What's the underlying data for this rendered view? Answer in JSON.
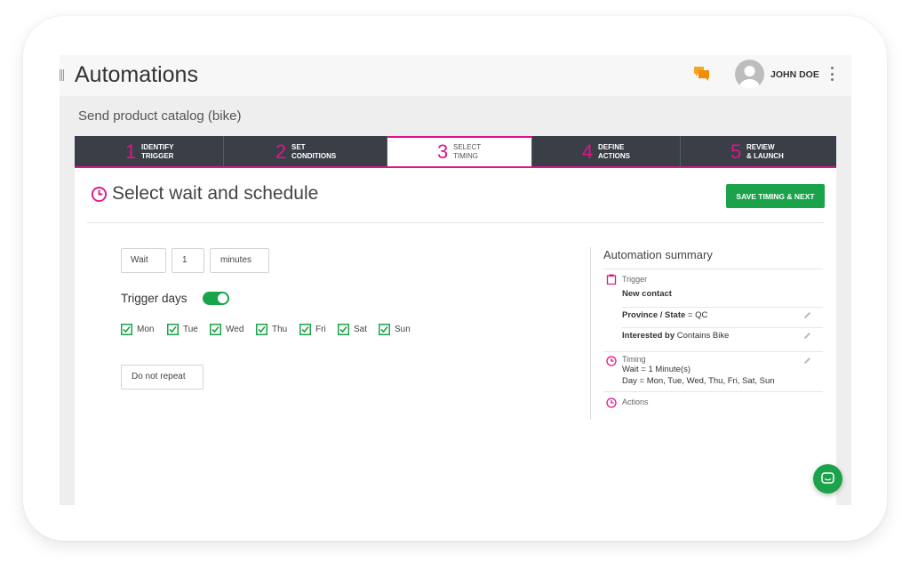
{
  "app": {
    "title": "Automations"
  },
  "user": {
    "name": "JOHN DOE"
  },
  "automation": {
    "name": "Send product catalog (bike)"
  },
  "steps": [
    {
      "num": "1",
      "line1": "IDENTIFY",
      "line2": "TRIGGER",
      "active": false
    },
    {
      "num": "2",
      "line1": "SET",
      "line2": "CONDITIONS",
      "active": false
    },
    {
      "num": "3",
      "line1": "SELECT",
      "line2": "TIMING",
      "active": true
    },
    {
      "num": "4",
      "line1": "DEFINE",
      "line2": "ACTIONS",
      "active": false
    },
    {
      "num": "5",
      "line1": "REVIEW",
      "line2": "& LAUNCH",
      "active": false
    }
  ],
  "page": {
    "title": "Select wait and schedule",
    "save_button": "SAVE TIMING & NEXT"
  },
  "wait": {
    "label": "Wait",
    "value": "1",
    "unit": "minutes"
  },
  "trigger_days": {
    "label": "Trigger days",
    "enabled": true,
    "days": [
      {
        "label": "Mon",
        "checked": true
      },
      {
        "label": "Tue",
        "checked": true
      },
      {
        "label": "Wed",
        "checked": true
      },
      {
        "label": "Thu",
        "checked": true
      },
      {
        "label": "Fri",
        "checked": true
      },
      {
        "label": "Sat",
        "checked": true
      },
      {
        "label": "Sun",
        "checked": true
      }
    ]
  },
  "repeat": {
    "value": "Do not repeat"
  },
  "summary": {
    "title": "Automation summary",
    "trigger_label": "Trigger",
    "trigger_value": "New contact",
    "condition1_key": "Province / State",
    "condition1_val": " = QC",
    "condition2_key": "Interested by",
    "condition2_val": " Contains Bike",
    "timing_label": "Timing",
    "timing_line1": "Wait = 1 Minute(s)",
    "timing_line2": "Day = Mon, Tue, Wed, Thu, Fri, Sat, Sun",
    "actions_label": "Actions"
  },
  "colors": {
    "accent": "#e0138c",
    "primary_green": "#1aa34a",
    "nav_dark": "#3a3f47",
    "chat_orange": "#f5a623"
  },
  "icons": [
    "drag-grip-icon",
    "chat-icon",
    "avatar-icon",
    "kebab-menu-icon",
    "clock-icon",
    "checkbox-checked-icon",
    "clipboard-icon",
    "pencil-icon",
    "chat-bubble-icon"
  ]
}
